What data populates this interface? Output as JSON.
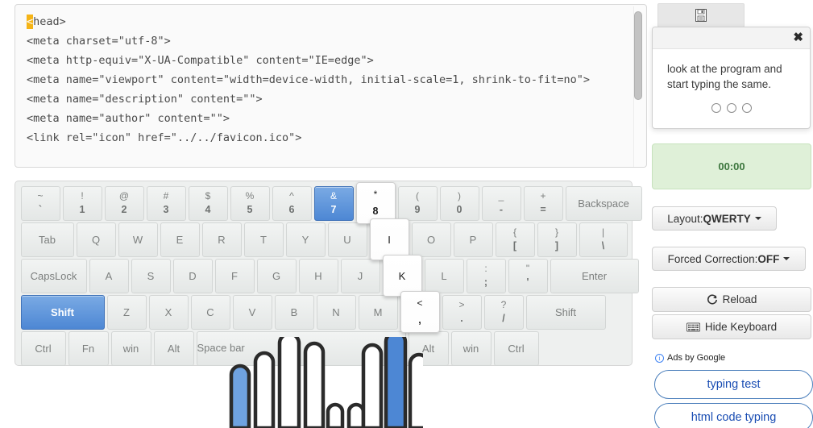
{
  "code_editor": {
    "highlighted_char": "<",
    "lines": [
      "head>",
      "<meta charset=\"utf-8\">",
      "<meta http-equiv=\"X-UA-Compatible\" content=\"IE=edge\">",
      "<meta name=\"viewport\" content=\"width=device-width, initial-scale=1, shrink-to-fit=no\">",
      "<meta name=\"description\" content=\"\">",
      "<meta name=\"author\" content=\"\">",
      "<link rel=\"icon\" href=\"../../favicon.ico\">"
    ]
  },
  "keyboard": {
    "rows": [
      [
        {
          "top": "~",
          "bot": "`",
          "w": "w1",
          "state": ""
        },
        {
          "top": "!",
          "bot": "1",
          "w": "w1",
          "state": ""
        },
        {
          "top": "@",
          "bot": "2",
          "w": "w1",
          "state": ""
        },
        {
          "top": "#",
          "bot": "3",
          "w": "w1",
          "state": ""
        },
        {
          "top": "$",
          "bot": "4",
          "w": "w1",
          "state": ""
        },
        {
          "top": "%",
          "bot": "5",
          "w": "w1",
          "state": ""
        },
        {
          "top": "^",
          "bot": "6",
          "w": "w1",
          "state": ""
        },
        {
          "top": "&",
          "bot": "7",
          "w": "w1",
          "state": "next"
        },
        {
          "top": "*",
          "bot": "8",
          "w": "w1",
          "state": "active"
        },
        {
          "top": "(",
          "bot": "9",
          "w": "w1",
          "state": ""
        },
        {
          "top": ")",
          "bot": "0",
          "w": "w1",
          "state": ""
        },
        {
          "top": "_",
          "bot": "-",
          "w": "w1",
          "state": ""
        },
        {
          "top": "+",
          "bot": "=",
          "w": "w1",
          "state": ""
        },
        {
          "label": "Backspace",
          "w": "wBack",
          "state": "",
          "word": true
        }
      ],
      [
        {
          "label": "Tab",
          "w": "wTab",
          "state": "",
          "word": true
        },
        {
          "label": "Q",
          "w": "w1",
          "state": ""
        },
        {
          "label": "W",
          "w": "w1",
          "state": ""
        },
        {
          "label": "E",
          "w": "w1",
          "state": ""
        },
        {
          "label": "R",
          "w": "w1",
          "state": ""
        },
        {
          "label": "T",
          "w": "w1",
          "state": ""
        },
        {
          "label": "Y",
          "w": "w1",
          "state": ""
        },
        {
          "label": "U",
          "w": "w1",
          "state": ""
        },
        {
          "label": "I",
          "w": "w1",
          "state": "active"
        },
        {
          "label": "O",
          "w": "w1",
          "state": ""
        },
        {
          "label": "P",
          "w": "w1",
          "state": ""
        },
        {
          "top": "{",
          "bot": "[",
          "w": "w1",
          "state": ""
        },
        {
          "top": "}",
          "bot": "]",
          "w": "w1",
          "state": ""
        },
        {
          "top": "|",
          "bot": "\\",
          "w": "wBsl",
          "state": ""
        }
      ],
      [
        {
          "label": "CapsLock",
          "w": "wCaps",
          "state": "",
          "word": true
        },
        {
          "label": "A",
          "w": "w1",
          "state": ""
        },
        {
          "label": "S",
          "w": "w1",
          "state": ""
        },
        {
          "label": "D",
          "w": "w1",
          "state": ""
        },
        {
          "label": "F",
          "w": "w1",
          "state": ""
        },
        {
          "label": "G",
          "w": "w1",
          "state": ""
        },
        {
          "label": "H",
          "w": "w1",
          "state": ""
        },
        {
          "label": "J",
          "w": "w1",
          "state": ""
        },
        {
          "label": "K",
          "w": "w1",
          "state": "active"
        },
        {
          "label": "L",
          "w": "w1",
          "state": ""
        },
        {
          "top": ":",
          "bot": ";",
          "w": "w1",
          "state": ""
        },
        {
          "top": "\"",
          "bot": "'",
          "w": "w1",
          "state": ""
        },
        {
          "label": "Enter",
          "w": "wEnter",
          "state": "",
          "word": true
        }
      ],
      [
        {
          "label": "Shift",
          "w": "wShiftL",
          "state": "next",
          "word": true
        },
        {
          "label": "Z",
          "w": "w1",
          "state": ""
        },
        {
          "label": "X",
          "w": "w1",
          "state": ""
        },
        {
          "label": "C",
          "w": "w1",
          "state": ""
        },
        {
          "label": "V",
          "w": "w1",
          "state": ""
        },
        {
          "label": "B",
          "w": "w1",
          "state": ""
        },
        {
          "label": "N",
          "w": "w1",
          "state": ""
        },
        {
          "label": "M",
          "w": "w1",
          "state": ""
        },
        {
          "top": "<",
          "bot": ",",
          "w": "w1",
          "state": "active"
        },
        {
          "top": ">",
          "bot": ".",
          "w": "w1",
          "state": ""
        },
        {
          "top": "?",
          "bot": "/",
          "w": "w1",
          "state": ""
        },
        {
          "label": "Shift",
          "w": "wShiftR",
          "state": "",
          "word": true
        }
      ],
      [
        {
          "label": "Ctrl",
          "w": "wCtrl",
          "state": "",
          "word": true
        },
        {
          "label": "Fn",
          "w": "wMod",
          "state": "",
          "word": true
        },
        {
          "label": "win",
          "w": "wMod",
          "state": "",
          "word": true
        },
        {
          "label": "Alt",
          "w": "wMod",
          "state": "",
          "word": true
        },
        {
          "label": "Space bar",
          "w": "wSpace",
          "state": "",
          "word": true
        },
        {
          "label": "Alt",
          "w": "wMod",
          "state": "",
          "word": true
        },
        {
          "label": "win",
          "w": "wMod",
          "state": "",
          "word": true
        },
        {
          "label": "Ctrl",
          "w": "wCtrl",
          "state": "",
          "word": true
        }
      ]
    ]
  },
  "rail": {
    "save_icon": "save-floppy-icon",
    "hint": {
      "close_label": "✖",
      "text": "look at the program and start typing the same.",
      "dots": 3
    },
    "timer": "00:00",
    "layout_button": {
      "prefix": "Layout: ",
      "value": "QWERTY"
    },
    "correction_button": {
      "prefix": "Forced Correction: ",
      "value": "OFF"
    },
    "reload_button": "Reload",
    "hide_keyboard_button": "Hide Keyboard",
    "ads_label": "Ads by Google",
    "ads": [
      "typing test",
      "html code typing"
    ]
  },
  "colors": {
    "next_key": "#4d87d4",
    "highlight_char": "#f5b417",
    "timer_bg": "#dff0d8",
    "timer_text": "#3c763d",
    "ad_link": "#1a4db3"
  }
}
